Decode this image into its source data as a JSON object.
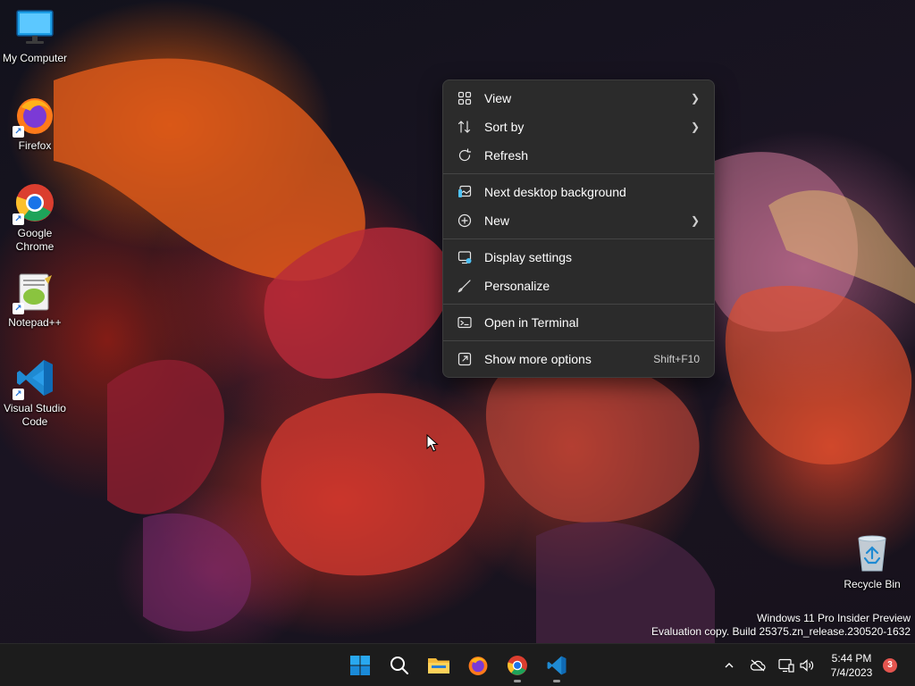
{
  "desktop": {
    "icons": [
      {
        "label": "My Computer"
      },
      {
        "label": "Firefox"
      },
      {
        "label": "Google Chrome"
      },
      {
        "label": "Notepad++"
      },
      {
        "label": "Visual Studio Code"
      }
    ],
    "recycle_bin": {
      "label": "Recycle Bin"
    }
  },
  "context_menu": {
    "items": [
      {
        "label": "View",
        "icon": "grid-icon",
        "submenu": true
      },
      {
        "label": "Sort by",
        "icon": "sort-icon",
        "submenu": true
      },
      {
        "label": "Refresh",
        "icon": "refresh-icon"
      },
      {
        "label": "Next desktop background",
        "icon": "background-icon"
      },
      {
        "label": "New",
        "icon": "plus-circle-icon",
        "submenu": true
      },
      {
        "label": "Display settings",
        "icon": "display-icon"
      },
      {
        "label": "Personalize",
        "icon": "brush-icon"
      },
      {
        "label": "Open in Terminal",
        "icon": "terminal-icon"
      },
      {
        "label": "Show more options",
        "icon": "share-icon",
        "shortcut": "Shift+F10"
      }
    ]
  },
  "watermark": {
    "line1": "Windows 11 Pro Insider Preview",
    "line2": "Evaluation copy. Build 25375.zn_release.230520-1632"
  },
  "taskbar": {
    "apps": [
      "start",
      "search",
      "file-explorer",
      "firefox",
      "chrome",
      "vscode"
    ],
    "clock": {
      "time": "5:44 PM",
      "date": "7/4/2023"
    },
    "notifications": "3"
  },
  "colors": {
    "menu_bg": "#2b2b2b",
    "taskbar_bg": "#1c1c1c",
    "accent": "#0078d4"
  }
}
